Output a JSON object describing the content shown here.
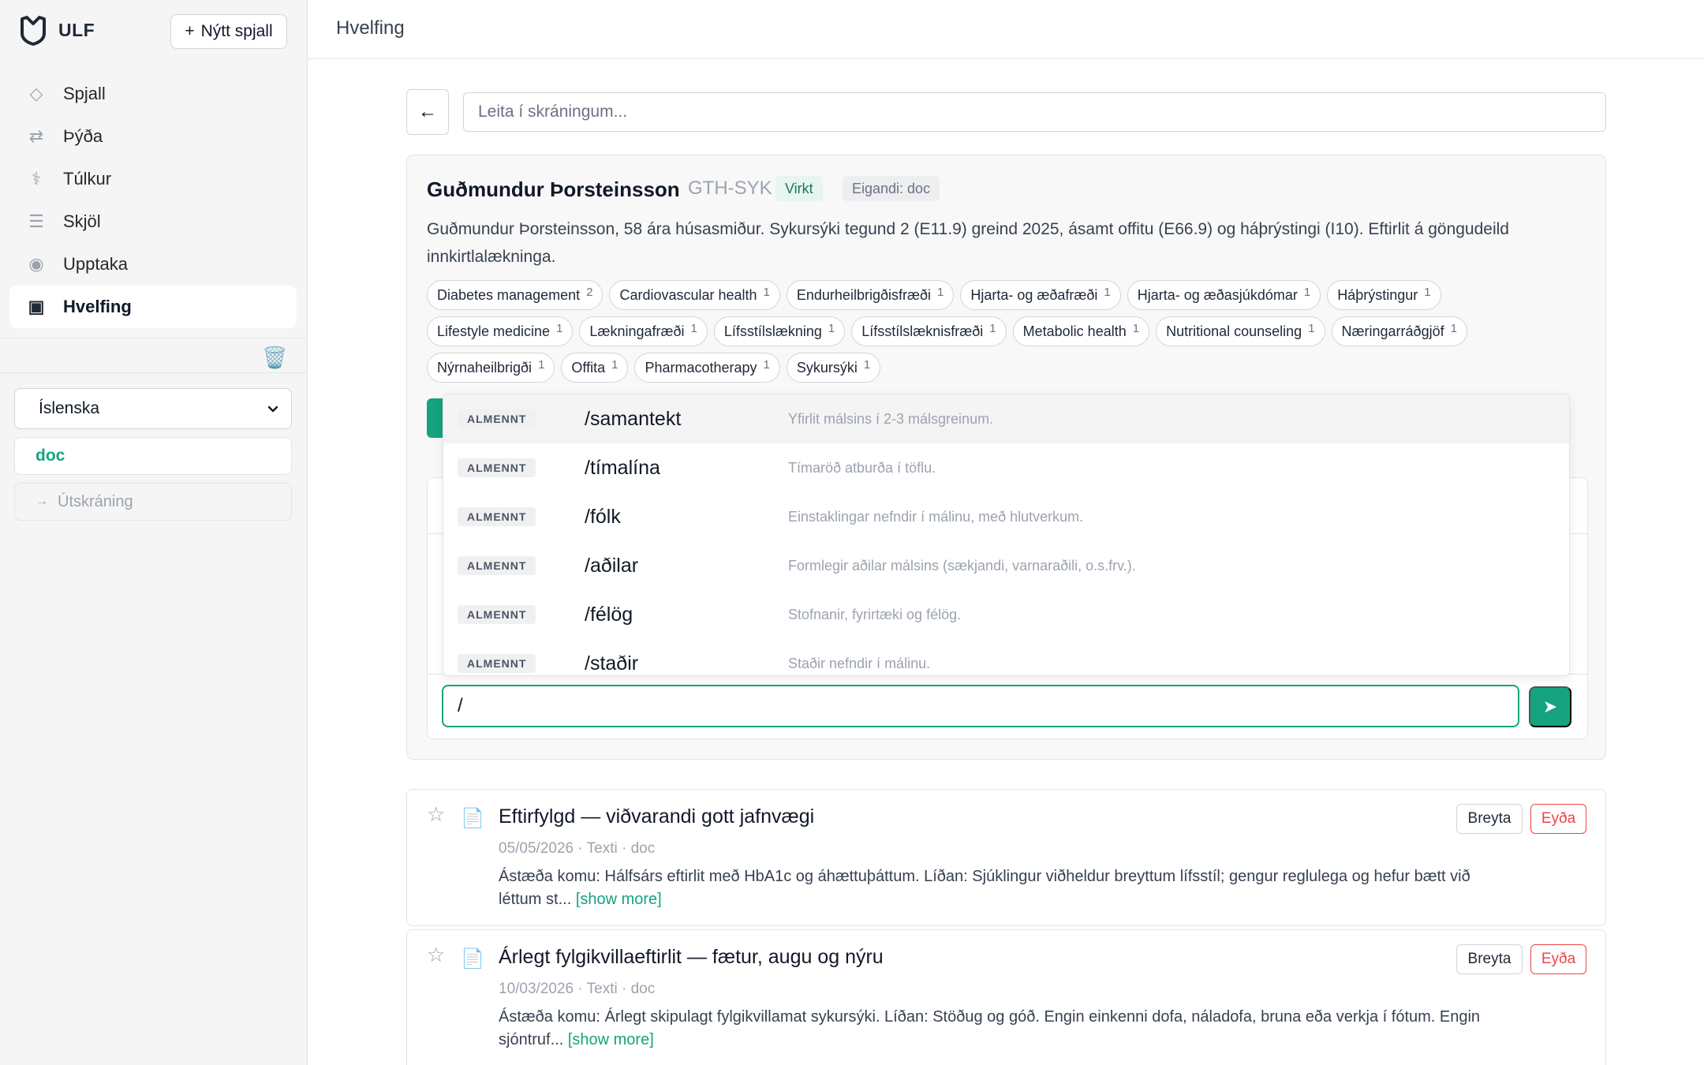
{
  "app": {
    "brand": "ULF",
    "new_chat_label": "Nýtt spjall"
  },
  "sidebar": {
    "items": [
      {
        "label": "Spjall",
        "icon": "diamond-icon",
        "glyph": "◇"
      },
      {
        "label": "Þýða",
        "icon": "swap-arrows-icon",
        "glyph": "⇄"
      },
      {
        "label": "Túlkur",
        "icon": "caduceus-icon",
        "glyph": "⚕"
      },
      {
        "label": "Skjöl",
        "icon": "list-icon",
        "glyph": "☰"
      },
      {
        "label": "Upptaka",
        "icon": "record-icon",
        "glyph": "◉"
      },
      {
        "label": "Hvelfing",
        "icon": "vault-icon",
        "glyph": "▣",
        "active": true
      }
    ],
    "trash_icon": "🗑️",
    "language": "Íslenska",
    "user": "doc",
    "logout_label": "Útskráning"
  },
  "header": {
    "title": "Hvelfing"
  },
  "main": {
    "back_icon": "←",
    "search_placeholder": "Leita í skráningum..."
  },
  "patient": {
    "name": "Guðmundur Þorsteinsson",
    "id": "GTH-SYK",
    "status": "Virkt",
    "owner": "Eigandi: doc",
    "description": "Guðmundur Þorsteinsson, 58 ára húsasmiður. Sykursýki tegund 2 (E11.9) greind 2025, ásamt offitu (E66.9) og háþrýstingi (I10). Eftirlit á göngudeild innkirtlalækninga.",
    "tags": [
      [
        {
          "label": "Diabetes management",
          "count": "2"
        },
        {
          "label": "Cardiovascular health",
          "count": "1"
        },
        {
          "label": "Endurheilbrigðisfræði",
          "count": "1"
        },
        {
          "label": "Hjarta- og æðafræði",
          "count": "1"
        },
        {
          "label": "Hjarta- og æðasjúkdómar",
          "count": "1"
        },
        {
          "label": "Háþrýstingur",
          "count": "1"
        }
      ],
      [
        {
          "label": "Lifestyle medicine",
          "count": "1"
        },
        {
          "label": "Lækningafræði",
          "count": "1"
        },
        {
          "label": "Lífsstílslækning",
          "count": "1"
        },
        {
          "label": "Lífsstílslæknisfræði",
          "count": "1"
        },
        {
          "label": "Metabolic health",
          "count": "1"
        },
        {
          "label": "Nutritional counseling",
          "count": "1"
        },
        {
          "label": "Næringarráðgjöf",
          "count": "1"
        }
      ],
      [
        {
          "label": "Nýrnaheilbrigði",
          "count": "1"
        },
        {
          "label": "Offita",
          "count": "1"
        },
        {
          "label": "Pharmacotherapy",
          "count": "1"
        },
        {
          "label": "Sykursýki",
          "count": "1"
        }
      ]
    ]
  },
  "chat": {
    "input_value": "/",
    "send_icon": "➤"
  },
  "commands": [
    {
      "category": "ALMENNT",
      "name": "/samantekt",
      "desc": "Yfirlit málsins í 2-3 málsgreinum."
    },
    {
      "category": "ALMENNT",
      "name": "/tímalína",
      "desc": "Tímaröð atburða í töflu."
    },
    {
      "category": "ALMENNT",
      "name": "/fólk",
      "desc": "Einstaklingar nefndir í málinu, með hlutverkum."
    },
    {
      "category": "ALMENNT",
      "name": "/aðilar",
      "desc": "Formlegir aðilar málsins (sækjandi, varnaraðili, o.s.frv.)."
    },
    {
      "category": "ALMENNT",
      "name": "/félög",
      "desc": "Stofnanir, fyrirtæki og félög."
    },
    {
      "category": "ALMENNT",
      "name": "/staðir",
      "desc": "Staðir nefndir í málinu."
    }
  ],
  "records": [
    {
      "title": "Eftirfylgd — viðvarandi gott jafnvægi",
      "meta": "05/05/2026 · Texti · doc",
      "body": "Ástæða komu: Hálfsárs eftirlit með HbA1c og áhættuþáttum. Líðan: Sjúklingur viðheldur breyttum lífsstíl; gengur reglulega og hefur bætt við léttum st...",
      "more": "[show more]",
      "edit": "Breyta",
      "delete": "Eyða"
    },
    {
      "title": "Árlegt fylgikvillaeftirlit — fætur, augu og nýru",
      "meta": "10/03/2026 · Texti · doc",
      "body": "Ástæða komu: Árlegt skipulagt fylgikvillamat sykursýki. Líðan: Stöðug og góð. Engin einkenni dofa, náladofa, bruna eða verkja í fótum. Engin sjóntruf...",
      "more": "[show more]",
      "edit": "Breyta",
      "delete": "Eyða"
    }
  ],
  "colors": {
    "accent": "#16a37f",
    "danger": "#ef4444",
    "sidebar_bg": "#f5f5f6"
  }
}
